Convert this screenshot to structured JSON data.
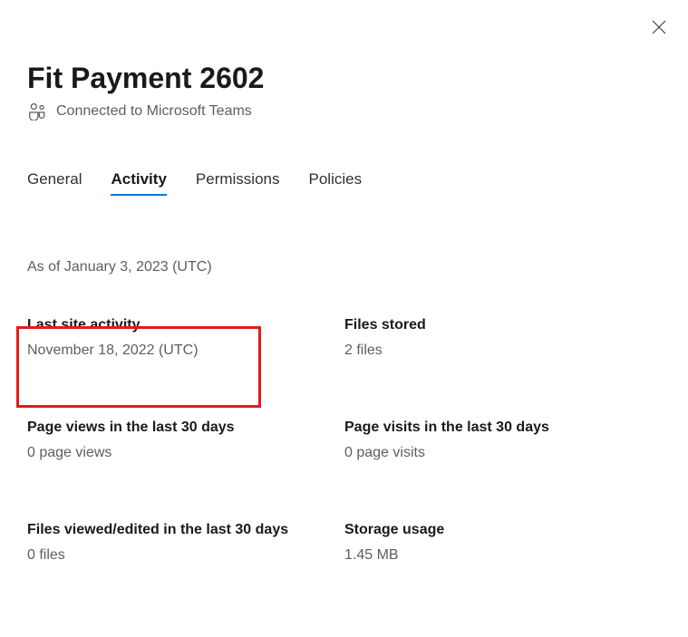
{
  "header": {
    "title": "Fit Payment 2602",
    "subtitle": "Connected to Microsoft Teams"
  },
  "tabs": {
    "general": "General",
    "activity": "Activity",
    "permissions": "Permissions",
    "policies": "Policies"
  },
  "asof": "As of January 3, 2023 (UTC)",
  "stats": {
    "last_activity": {
      "label": "Last site activity",
      "value": "November 18, 2022 (UTC)"
    },
    "files_stored": {
      "label": "Files stored",
      "value": "2 files"
    },
    "page_views": {
      "label": "Page views in the last 30 days",
      "value": "0 page views"
    },
    "page_visits": {
      "label": "Page visits in the last 30 days",
      "value": "0 page visits"
    },
    "files_viewed": {
      "label": "Files viewed/edited in the last 30 days",
      "value": "0 files"
    },
    "storage": {
      "label": "Storage usage",
      "value": "1.45 MB"
    }
  }
}
